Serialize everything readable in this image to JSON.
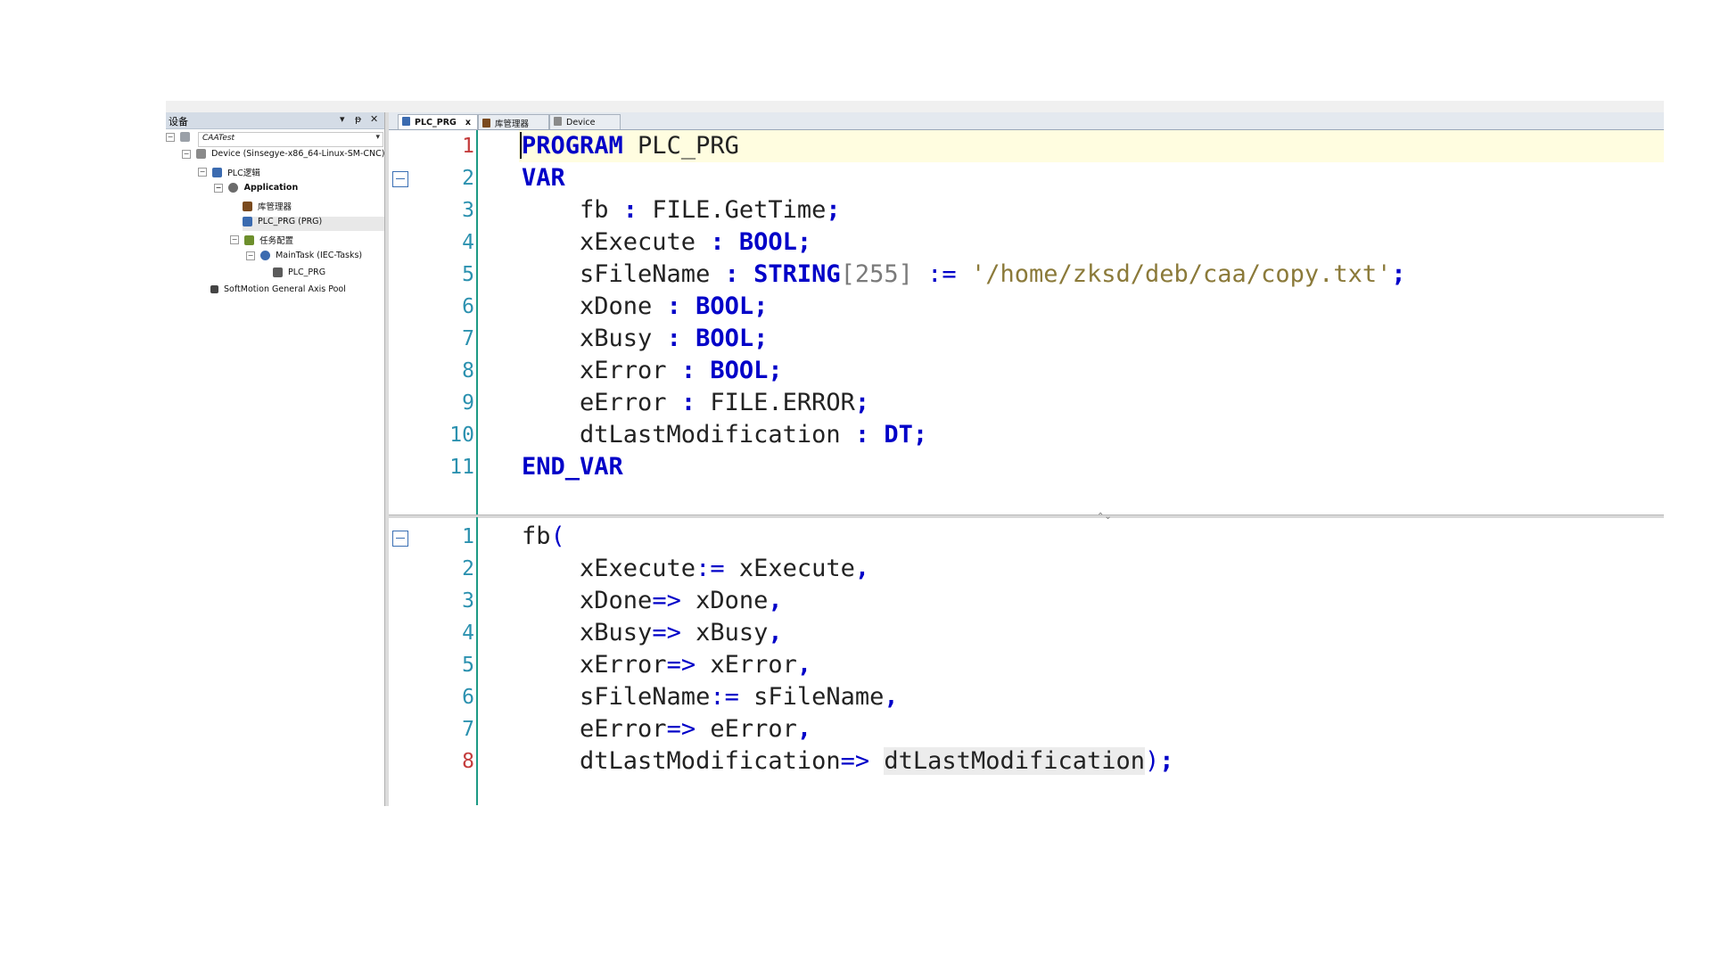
{
  "device_panel": {
    "title": "设备",
    "controls": [
      "▾",
      "ᵽ",
      "✕"
    ],
    "project": "CAATest",
    "tree": [
      {
        "label": "Device (Sinsegye-x86_64-Linux-SM-CNC)",
        "icon": "device-icon",
        "color": "#8a8a8a"
      },
      {
        "label": "PLC逻辑",
        "icon": "plc-logic-icon",
        "color": "#3b6bb0"
      },
      {
        "label": "Application",
        "icon": "application-icon",
        "color": "#6b6b6b"
      },
      {
        "label": "库管理器",
        "icon": "library-manager-icon",
        "color": "#7a4a1e"
      },
      {
        "label": "PLC_PRG (PRG)",
        "icon": "program-icon",
        "color": "#3b6bb0"
      },
      {
        "label": "任务配置",
        "icon": "task-config-icon",
        "color": "#6d8f2c"
      },
      {
        "label": "MainTask (IEC-Tasks)",
        "icon": "task-icon",
        "color": "#3b6bb0"
      },
      {
        "label": "PLC_PRG",
        "icon": "program-call-icon",
        "color": "#5b5b5b"
      },
      {
        "label": "SoftMotion General Axis Pool",
        "icon": "axis-pool-icon",
        "color": "#444444"
      }
    ]
  },
  "tabs": [
    {
      "label": "PLC_PRG",
      "close": "x",
      "active": true,
      "icon": "program-icon"
    },
    {
      "label": "库管理器",
      "active": false,
      "icon": "library-manager-icon"
    },
    {
      "label": "Device",
      "active": false,
      "icon": "device-icon"
    }
  ],
  "declaration": {
    "line_numbers": [
      "1",
      "2",
      "3",
      "4",
      "5",
      "6",
      "7",
      "8",
      "9",
      "10",
      "11"
    ],
    "lines": {
      "l1_kw": "PROGRAM",
      "l1_name": " PLC_PRG",
      "l2_kw": "VAR",
      "l3_a": "    fb ",
      "l3_colon": ":",
      "l3_type": " FILE.GetTime",
      "l3_semi": ";",
      "l4_a": "    xExecute ",
      "l4_colon": ":",
      "l4_type": " BOOL",
      "l4_semi": ";",
      "l5_a": "    sFileName ",
      "l5_colon": ":",
      "l5_type": " STRING",
      "l5_len": "[255]",
      "l5_assign": " :=",
      "l5_str": " '/home/zksd/deb/caa/copy.txt'",
      "l5_semi": ";",
      "l6_a": "    xDone ",
      "l6_colon": ":",
      "l6_type": " BOOL",
      "l6_semi": ";",
      "l7_a": "    xBusy ",
      "l7_colon": ":",
      "l7_type": " BOOL",
      "l7_semi": ";",
      "l8_a": "    xError ",
      "l8_colon": ":",
      "l8_type": " BOOL",
      "l8_semi": ";",
      "l9_a": "    eError ",
      "l9_colon": ":",
      "l9_type": " FILE.ERROR",
      "l9_semi": ";",
      "l10_a": "    dtLastModification ",
      "l10_colon": ":",
      "l10_type": " DT",
      "l10_semi": ";",
      "l11_kw": "END_VAR"
    }
  },
  "implementation": {
    "line_numbers": [
      "1",
      "2",
      "3",
      "4",
      "5",
      "6",
      "7",
      "8"
    ],
    "lines": {
      "i1_a": "fb",
      "i1_b": "(",
      "i2_a": "    xExecute",
      "i2_op": ":=",
      "i2_b": " xExecute",
      "i2_c": ",",
      "i3_a": "    xDone",
      "i3_op": "=>",
      "i3_b": " xDone",
      "i3_c": ",",
      "i4_a": "    xBusy",
      "i4_op": "=>",
      "i4_b": " xBusy",
      "i4_c": ",",
      "i5_a": "    xError",
      "i5_op": "=>",
      "i5_b": " xError",
      "i5_c": ",",
      "i6_a": "    sFileName",
      "i6_op": ":=",
      "i6_b": " sFileName",
      "i6_c": ",",
      "i7_a": "    eError",
      "i7_op": "=>",
      "i7_b": " eError",
      "i7_c": ",",
      "i8_a": "    dtLastModification",
      "i8_op": "=>",
      "i8_sp": " ",
      "i8_b": "dtLastModification",
      "i8_c": ")",
      "i8_d": ";"
    }
  },
  "colors": {
    "keyword": "#0000c8",
    "string": "#8b7a3a",
    "line_number": "#2b91af",
    "gutter_accent": "#1c9a84",
    "current_line": "#fffde0"
  }
}
